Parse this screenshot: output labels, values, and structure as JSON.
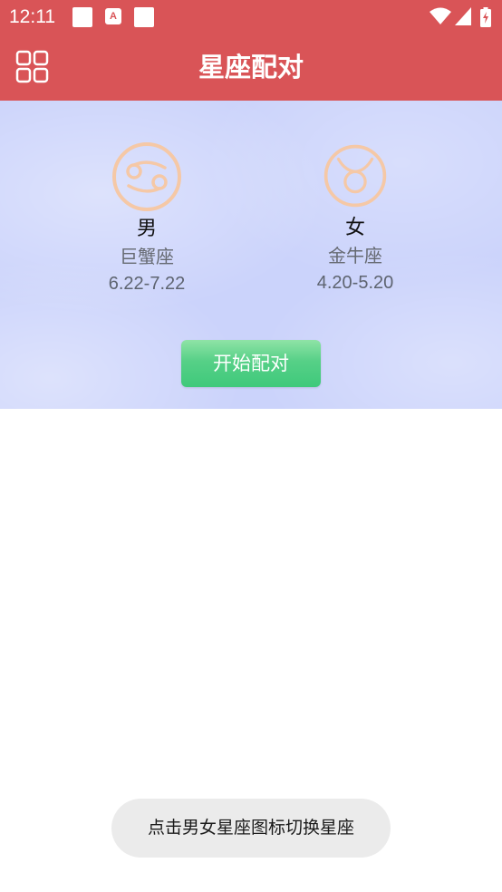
{
  "status_bar": {
    "time": "12:11",
    "background": "#d95457",
    "notification_icons": [
      "square-notification-icon",
      "app-a-notification-icon",
      "square-notification-icon"
    ],
    "notif_a_letter": "A",
    "system_icons": [
      "wifi-icon",
      "cellular-signal-icon",
      "battery-charging-icon"
    ]
  },
  "app_bar": {
    "title": "星座配对",
    "menu_icon": "grid-menu-icon",
    "background": "#d95457"
  },
  "male": {
    "gender_label": "男",
    "sign_name": "巨蟹座",
    "date_range": "6.22-7.22",
    "icon": "cancer-zodiac-icon"
  },
  "female": {
    "gender_label": "女",
    "sign_name": "金牛座",
    "date_range": "4.20-5.20",
    "icon": "taurus-zodiac-icon"
  },
  "start_button": {
    "label": "开始配对",
    "color": "#4fce84"
  },
  "toast": {
    "message": "点击男女星座图标切换星座"
  },
  "colors": {
    "accent": "#d95457",
    "hero_background": "#cbd3fb",
    "zodiac_icon": "#f5c8a6"
  }
}
